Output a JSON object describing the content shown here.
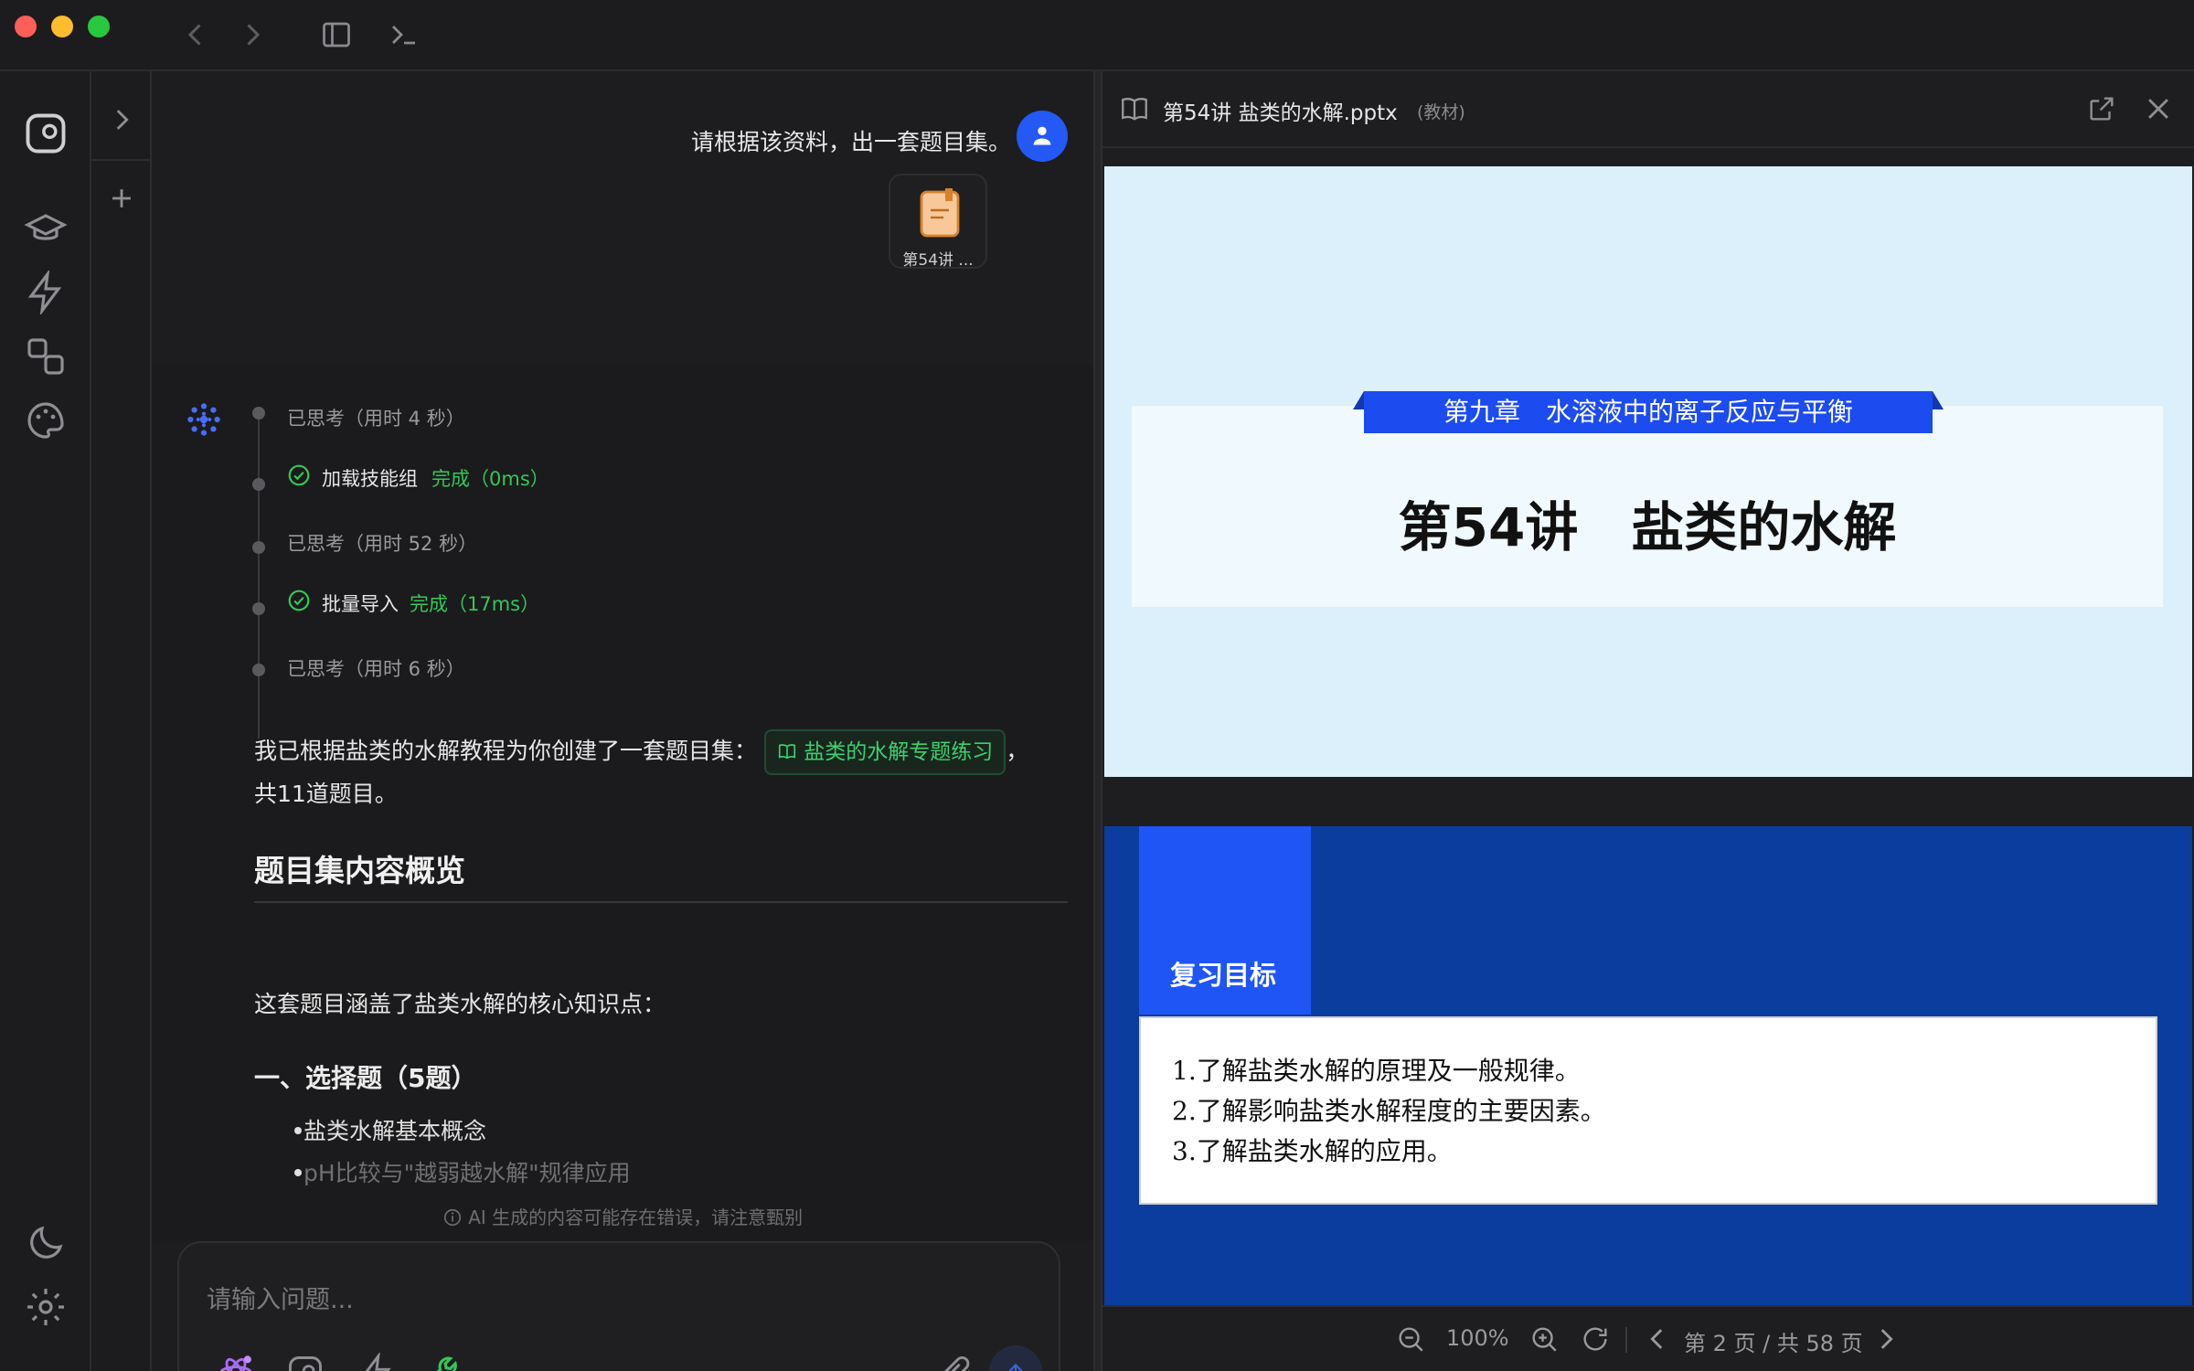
{
  "window": {
    "traffic_colors": {
      "close": "#ff5f57",
      "minimize": "#febc2e",
      "maximize": "#28c840"
    }
  },
  "chat": {
    "user_message": "请根据该资料，出一套题目集。",
    "attachment_label": "第54讲 ...",
    "steps": [
      {
        "type": "thought",
        "text": "已思考（用时 4 秒）"
      },
      {
        "type": "tool",
        "name": "加载技能组",
        "status": "完成（0ms）"
      },
      {
        "type": "thought",
        "text": "已思考（用时 52 秒）"
      },
      {
        "type": "tool",
        "name": "批量导入",
        "status": "完成（17ms）"
      },
      {
        "type": "thought",
        "text": "已思考（用时 6 秒）"
      }
    ],
    "reply_prefix": "我已根据盐类的水解教程为你创建了一套题目集：",
    "reply_chip": "盐类的水解专题练习",
    "reply_suffix": "，",
    "reply_line2": "共11道题目。",
    "section_heading": "题目集内容概览",
    "section_intro": "这套题目涵盖了盐类水解的核心知识点：",
    "sub_heading": "一、选择题（5题）",
    "bullets": [
      "盐类水解基本概念",
      "pH比较与\"越弱越水解\"规律应用"
    ],
    "disclaimer": "AI 生成的内容可能存在错误，请注意甄别",
    "input_placeholder": "请输入问题..."
  },
  "preview": {
    "file_title": "第54讲 盐类的水解.pptx",
    "file_tag": "(教材)",
    "slide1": {
      "ribbon": "第九章　水溶液中的离子反应与平衡",
      "title": "第54讲　盐类的水解"
    },
    "slide2": {
      "tab_label": "复习目标",
      "lines": [
        "1.了解盐类水解的原理及一般规律。",
        "2.了解影响盐类水解程度的主要因素。",
        "3.了解盐类水解的应用。"
      ]
    },
    "zoom": "100%",
    "page_indicator": "第 2 页 / 共 58 页"
  }
}
